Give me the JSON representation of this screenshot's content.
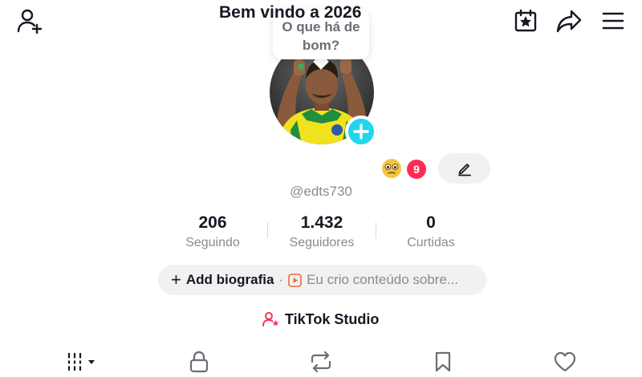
{
  "header": {
    "bubble_text": "O que há de bom?"
  },
  "profile": {
    "display_name": "Bem vindo a 2026",
    "emoji": "🥹",
    "notification_count": "9",
    "handle": "@edts730"
  },
  "stats": [
    {
      "value": "206",
      "label": "Seguindo"
    },
    {
      "value": "1.432",
      "label": "Seguidores"
    },
    {
      "value": "0",
      "label": "Curtidas"
    }
  ],
  "bio": {
    "add_label": "Add biografia",
    "separator": "·",
    "hint": "Eu crio conteúdo sobre..."
  },
  "studio": {
    "label": "TikTok Studio"
  },
  "colors": {
    "accent_cyan": "#20d5ec",
    "accent_red": "#fe2c55",
    "text_primary": "#161823",
    "text_secondary": "#8a8b91",
    "pill_bg": "#f1f1f2"
  },
  "icons": {
    "top_left": "add-friend-icon",
    "top_right": [
      "calendar-star-icon",
      "share-icon",
      "menu-icon"
    ],
    "tabs": [
      "grid-icon",
      "lock-icon",
      "repost-icon",
      "bookmark-icon",
      "heart-icon"
    ]
  }
}
